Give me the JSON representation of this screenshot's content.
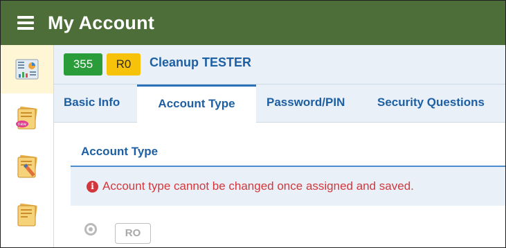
{
  "app": {
    "title": "My Account"
  },
  "header": {
    "badge_count": "355",
    "badge_role": "R0",
    "user_name": "Cleanup TESTER"
  },
  "sidebar": {
    "items": [
      {
        "icon": "dashboard-icon",
        "active": true
      },
      {
        "icon": "new-document-icon",
        "active": false
      },
      {
        "icon": "edit-document-icon",
        "active": false
      },
      {
        "icon": "document-icon",
        "active": false
      }
    ]
  },
  "tabs": [
    {
      "label": "Basic Info",
      "active": false
    },
    {
      "label": "Account Type",
      "active": true
    },
    {
      "label": "Password/PIN",
      "active": false
    },
    {
      "label": "Security Questions",
      "active": false
    }
  ],
  "section": {
    "title": "Account Type",
    "notice": "Account type cannot be changed once assigned and saved.",
    "option_label": "RO"
  },
  "colors": {
    "topbar": "#4e6e39",
    "accent_blue": "#1d5fa3",
    "badge_green": "#2a9c3a",
    "badge_yellow": "#f6c20a",
    "error_red": "#d3373b"
  }
}
